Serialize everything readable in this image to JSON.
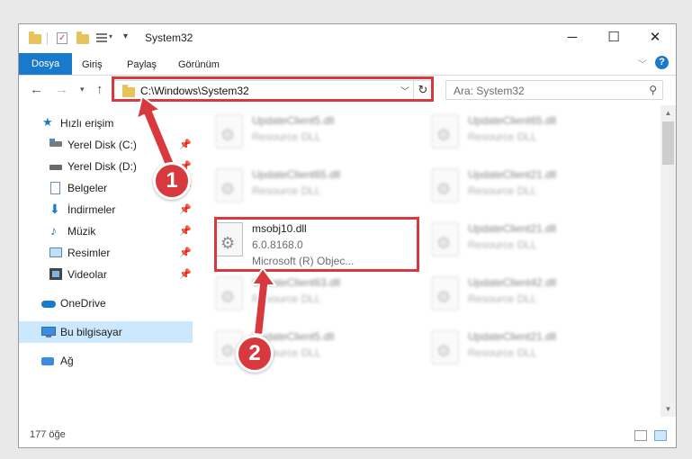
{
  "window": {
    "title": "System32",
    "controls": {
      "minimize": "─",
      "maximize": "☐",
      "close": "✕"
    }
  },
  "ribbon": {
    "tabs": [
      "Dosya",
      "Giriş",
      "Paylaş",
      "Görünüm"
    ],
    "help": "?"
  },
  "address_bar": {
    "path": "C:\\Windows\\System32",
    "search_placeholder": "Ara: System32"
  },
  "sidebar": {
    "items": [
      {
        "label": "Hızlı erişim",
        "icon": "star-icon",
        "pinned": false
      },
      {
        "label": "Yerel Disk (C:)",
        "icon": "drive-icon",
        "pinned": true
      },
      {
        "label": "Yerel Disk (D:)",
        "icon": "drive-icon",
        "pinned": true
      },
      {
        "label": "Belgeler",
        "icon": "documents-icon",
        "pinned": true
      },
      {
        "label": "İndirmeler",
        "icon": "download-icon",
        "pinned": true
      },
      {
        "label": "Müzik",
        "icon": "music-icon",
        "pinned": true
      },
      {
        "label": "Resimler",
        "icon": "pictures-icon",
        "pinned": true
      },
      {
        "label": "Videolar",
        "icon": "videos-icon",
        "pinned": true
      },
      {
        "label": "OneDrive",
        "icon": "cloud-icon",
        "pinned": false
      },
      {
        "label": "Bu bilgisayar",
        "icon": "computer-icon",
        "pinned": false,
        "selected": true
      },
      {
        "label": "Ağ",
        "icon": "network-icon",
        "pinned": false
      }
    ]
  },
  "files": {
    "blurred_left": [
      {
        "name": "UpdateClient5.dll",
        "desc": "Resource DLL"
      },
      {
        "name": "UpdateClient65.dll",
        "desc": "Resource DLL"
      },
      {
        "name": "UpdateClient63.dll",
        "desc": "Resource DLL"
      },
      {
        "name": "UpdateClient5.dll",
        "desc": "Resource DLL"
      }
    ],
    "blurred_right": [
      {
        "name": "UpdateClient65.dll",
        "desc": "Resource DLL"
      },
      {
        "name": "UpdateClient21.dll",
        "desc": "Resource DLL"
      },
      {
        "name": "UpdateClient21.dll",
        "desc": "Resource DLL"
      },
      {
        "name": "UpdateClient42.dll",
        "desc": "Resource DLL"
      },
      {
        "name": "UpdateClient21.dll",
        "desc": "Resource DLL"
      }
    ],
    "highlighted": {
      "name": "msobj10.dll",
      "version": "6.0.8168.0",
      "description": "Microsoft (R) Objec..."
    }
  },
  "status": {
    "item_count": "177 öğe"
  },
  "annotations": {
    "step1": "1",
    "step2": "2"
  },
  "colors": {
    "accent": "#1979ca",
    "highlight": "#d8393f",
    "selected": "#cce8ff"
  }
}
